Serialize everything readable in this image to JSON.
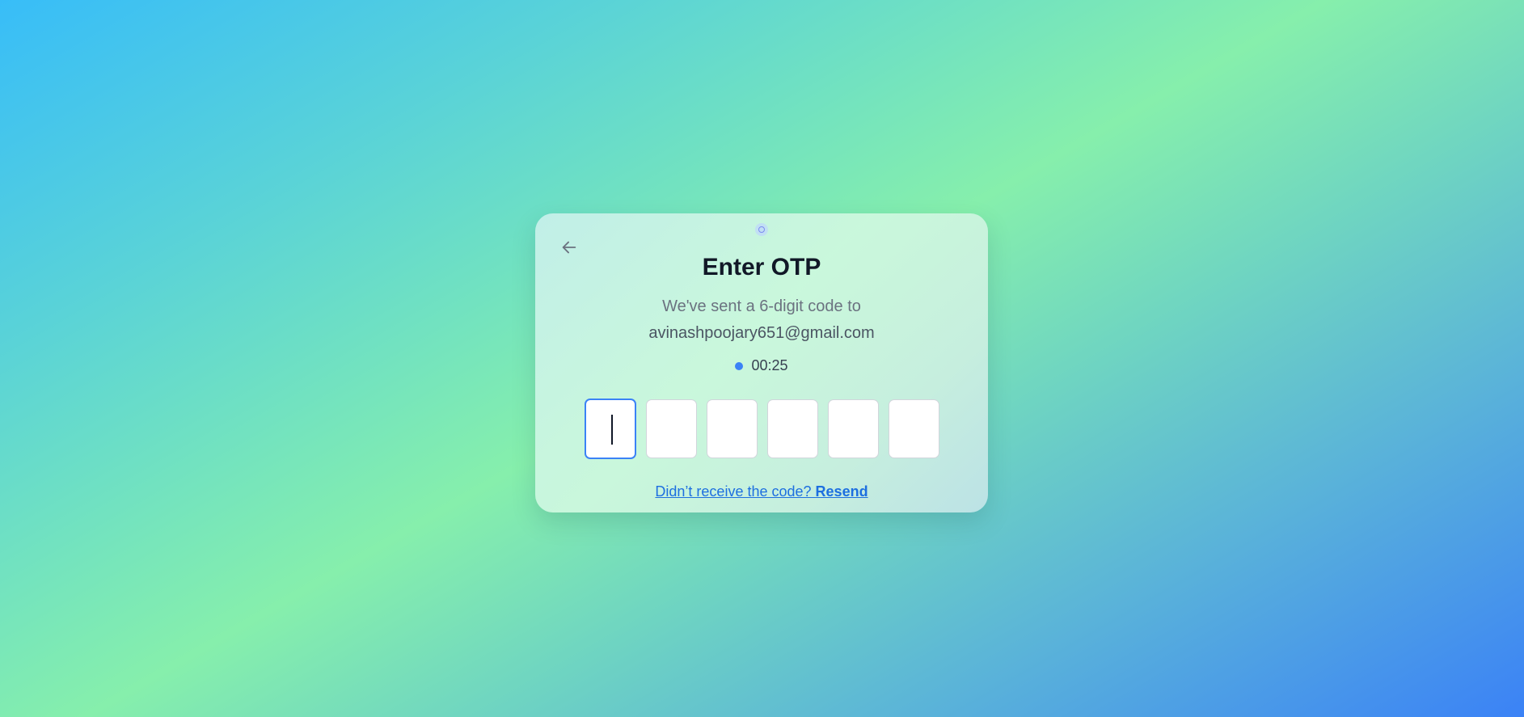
{
  "card": {
    "title": "Enter OTP",
    "subtitle": "We've sent a 6-digit code to",
    "email": "avinashpoojary651@gmail.com",
    "timer": "00:25",
    "resend_prompt": "Didn’t receive the code?",
    "resend_action": "Resend"
  },
  "otp": {
    "digits": [
      "",
      "",
      "",
      "",
      "",
      ""
    ],
    "active_index": 0
  },
  "icons": {
    "back": "arrow-left-icon",
    "timer": "timer-dot-icon",
    "top": "status-ring-icon"
  },
  "colors": {
    "accent": "#3b82f6",
    "link": "#1d6fe0",
    "title": "#111827",
    "muted": "#6b7280"
  }
}
